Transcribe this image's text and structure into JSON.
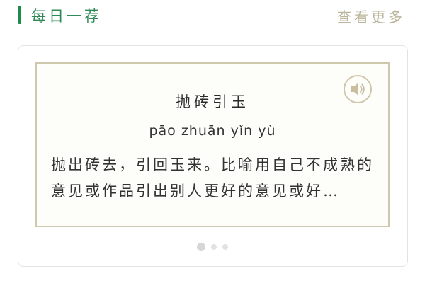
{
  "header": {
    "title": "每日一荐",
    "more_label": "查看更多"
  },
  "idiom": {
    "word": "抛砖引玉",
    "pinyin": "pāo zhuān yǐn yù",
    "description": "抛出砖去，引回玉来。比喻用自己不成熟的意见或作品引出别人更好的意见或好…"
  },
  "speaker": {
    "icon": "speaker-icon"
  },
  "pagination": {
    "count": 3,
    "active_index": 0
  },
  "colors": {
    "accent": "#1f8a4c",
    "title_green": "#2f8a57",
    "muted": "#b9b49a",
    "frame": "#cfc8ac"
  }
}
